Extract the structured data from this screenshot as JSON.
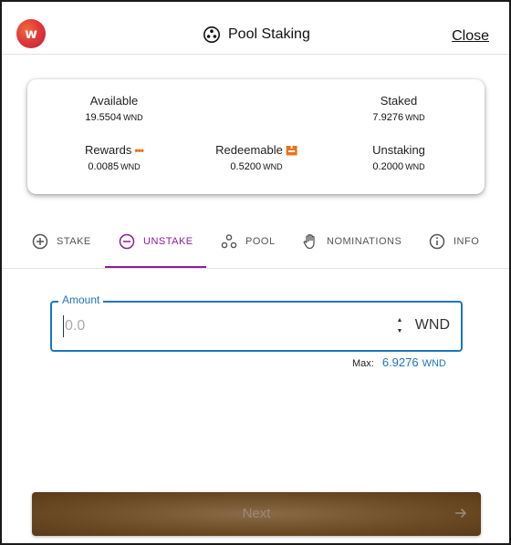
{
  "header": {
    "logo_letter": "w",
    "title": "Pool Staking",
    "close_label": "Close",
    "title_icon": "pool-icon"
  },
  "balances": {
    "available": {
      "label": "Available",
      "int": "19",
      "dec": ".5504",
      "unit": "WND"
    },
    "staked": {
      "label": "Staked",
      "int": "7",
      "dec": ".9276",
      "unit": "WND"
    },
    "rewards": {
      "label": "Rewards",
      "int": "0",
      "dec": ".0085",
      "unit": "WND",
      "icon": "more-dots-icon"
    },
    "redeemable": {
      "label": "Redeemable",
      "int": "0",
      "dec": ".5200",
      "unit": "WND",
      "icon": "redeem-box-icon"
    },
    "unstaking": {
      "label": "Unstaking",
      "int": "0",
      "dec": ".2000",
      "unit": "WND"
    }
  },
  "tabs": [
    {
      "label": "STAKE",
      "icon": "plus-circle-icon",
      "active": false
    },
    {
      "label": "UNSTAKE",
      "icon": "minus-circle-icon",
      "active": true
    },
    {
      "label": "POOL",
      "icon": "pool-icon",
      "active": false
    },
    {
      "label": "NOMINATIONS",
      "icon": "hand-icon",
      "active": false
    },
    {
      "label": "INFO",
      "icon": "info-icon",
      "active": false
    }
  ],
  "amount": {
    "label": "Amount",
    "placeholder": "0.0",
    "value": "",
    "unit": "WND",
    "max_label": "Max:",
    "max_value": "6.9276",
    "max_unit": "WND"
  },
  "next_button": {
    "label": "Next",
    "icon": "arrow-right-icon"
  },
  "colors": {
    "accent_purple": "#8b1d9b",
    "accent_blue": "#1c76bd",
    "rewards_orange": "#e8731a",
    "button_brown": "#6b4a25"
  }
}
